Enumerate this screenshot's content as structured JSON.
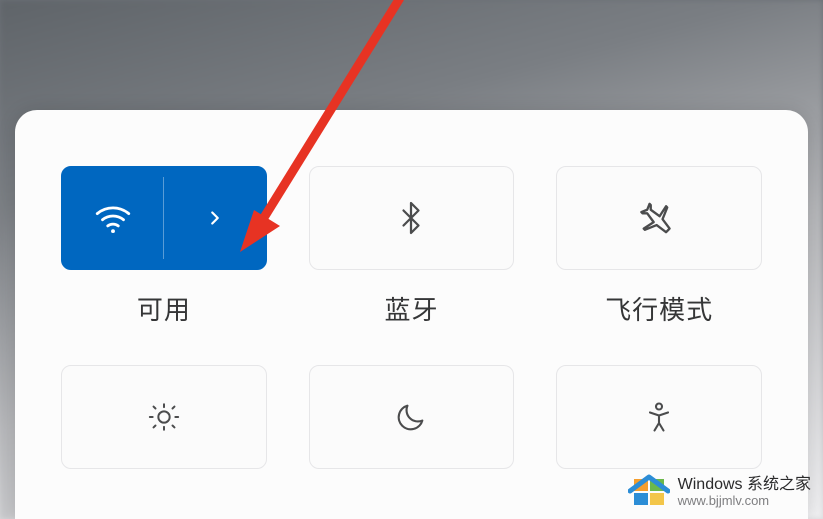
{
  "colors": {
    "accent": "#0067c0",
    "panel_bg": "#fcfcfc",
    "tile_bg": "#fbfbfb",
    "tile_border": "#e6e6e8",
    "text": "#353637",
    "arrow": "#e73323"
  },
  "tiles": {
    "wifi": {
      "label": "可用",
      "active": true,
      "icon": "wifi-icon",
      "expand_icon": "chevron-right-icon"
    },
    "bluetooth": {
      "label": "蓝牙",
      "active": false,
      "icon": "bluetooth-icon"
    },
    "airplane": {
      "label": "飞行模式",
      "active": false,
      "icon": "airplane-icon"
    },
    "brightness": {
      "icon": "brightness-icon"
    },
    "night": {
      "icon": "moon-icon"
    },
    "accessibility": {
      "icon": "accessibility-icon"
    }
  },
  "watermark": {
    "title": "Windows 系统之家",
    "url": "www.bjjmlv.com"
  },
  "annotation": {
    "type": "arrow",
    "target": "wifi-expand"
  }
}
